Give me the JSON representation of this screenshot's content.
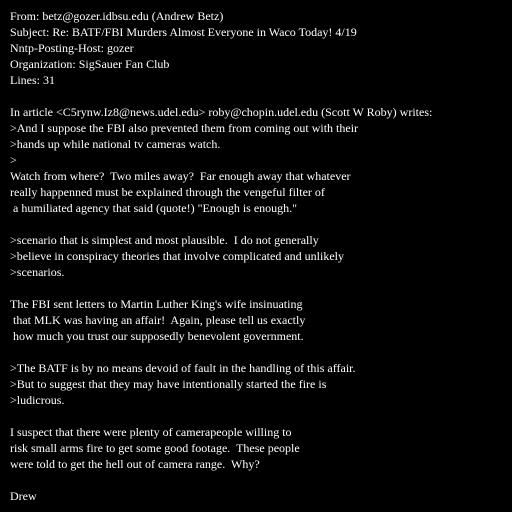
{
  "headers": {
    "from": "From: betz@gozer.idbsu.edu (Andrew Betz)",
    "subject": "Subject: Re: BATF/FBI Murders Almost Everyone in Waco Today! 4/19",
    "nntp_host": "Nntp-Posting-Host: gozer",
    "organization": "Organization: SigSauer Fan Club",
    "lines": "Lines: 31"
  },
  "body": {
    "attribution": "In article <C5rynw.Iz8@news.udel.edu> roby@chopin.udel.edu (Scott W Roby) writes:",
    "quote1": [
      ">And I suppose the FBI also prevented them from coming out with their",
      ">hands up while national tv cameras watch.",
      ">"
    ],
    "reply1": [
      "Watch from where?  Two miles away?  Far enough away that whatever",
      "really happenned must be explained through the vengeful filter of",
      " a humiliated agency that said (quote!) \"Enough is enough.\""
    ],
    "quote2": [
      ">scenario that is simplest and most plausible.  I do not generally",
      ">believe in conspiracy theories that involve complicated and unlikely",
      ">scenarios."
    ],
    "reply2": [
      "The FBI sent letters to Martin Luther King's wife insinuating",
      " that MLK was having an affair!  Again, please tell us exactly",
      " how much you trust our supposedly benevolent government."
    ],
    "quote3": [
      ">The BATF is by no means devoid of fault in the handling of this affair.",
      ">But to suggest that they may have intentionally started the fire is",
      ">ludicrous."
    ],
    "reply3": [
      "I suspect that there were plenty of camerapeople willing to",
      "risk small arms fire to get some good footage.  These people",
      "were told to get the hell out of camera range.  Why?"
    ],
    "signature": "Drew"
  }
}
